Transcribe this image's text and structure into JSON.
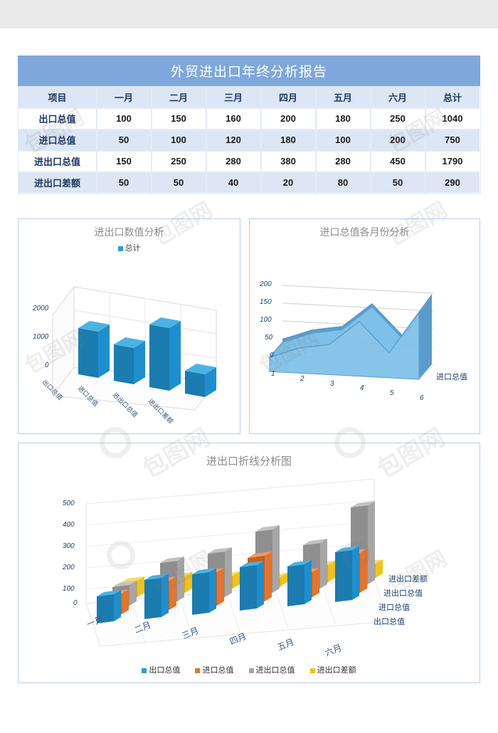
{
  "report": {
    "title": "外贸进出口年终分析报告"
  },
  "table": {
    "headers": [
      "项目",
      "一月",
      "二月",
      "三月",
      "四月",
      "五月",
      "六月",
      "总计"
    ],
    "rows": [
      {
        "label": "出口总值",
        "values": [
          100,
          150,
          160,
          200,
          180,
          250,
          1040
        ]
      },
      {
        "label": "进口总值",
        "values": [
          50,
          100,
          120,
          180,
          100,
          200,
          750
        ]
      },
      {
        "label": "进出口总值",
        "values": [
          150,
          250,
          280,
          380,
          280,
          450,
          1790
        ]
      },
      {
        "label": "进出口差额",
        "values": [
          50,
          50,
          40,
          20,
          80,
          50,
          290
        ]
      }
    ]
  },
  "colors": {
    "title_band": "#7FA7DC",
    "table_header": "#DCE6F4",
    "table_alt_row": "#DCE6F4",
    "series_export": "#2E9BD6",
    "series_import": "#E8732A",
    "series_total": "#A6A6A6",
    "series_diff": "#F2C218",
    "area_fill": "#7EC0E8",
    "panel_border": "#B9CDEA"
  },
  "chart_data": [
    {
      "id": "chart-values-analysis",
      "type": "bar",
      "title": "进出口数值分析",
      "legend": [
        "总计"
      ],
      "legend_position": "top",
      "categories": [
        "出口总值",
        "进口总值",
        "进出口总值",
        "进出口差额"
      ],
      "values": [
        1040,
        750,
        1790,
        290
      ],
      "ylabel": "",
      "xlabel": "",
      "yticks": [
        0,
        1000,
        2000
      ],
      "ylim": [
        0,
        2000
      ],
      "grid": true,
      "three_d": true
    },
    {
      "id": "chart-import-monthly",
      "type": "area",
      "title": "进口总值各月份分析",
      "series_name": "进口总值",
      "categories": [
        "1",
        "2",
        "3",
        "4",
        "5",
        "6"
      ],
      "values": [
        50,
        100,
        120,
        180,
        100,
        200
      ],
      "yticks": [
        0,
        50,
        100,
        150,
        200
      ],
      "ylim": [
        0,
        200
      ],
      "xlabel": "",
      "ylabel": "",
      "grid": true,
      "three_d": true
    },
    {
      "id": "chart-trade-breakdown",
      "type": "bar",
      "title": "进出口折线分析图",
      "categories": [
        "一月",
        "二月",
        "三月",
        "四月",
        "五月",
        "六月"
      ],
      "series": [
        {
          "name": "出口总值",
          "values": [
            100,
            150,
            160,
            200,
            180,
            250
          ]
        },
        {
          "name": "进口总值",
          "values": [
            50,
            100,
            120,
            180,
            100,
            200
          ]
        },
        {
          "name": "进出口总值",
          "values": [
            150,
            250,
            280,
            380,
            280,
            450
          ]
        },
        {
          "name": "进出口差额",
          "values": [
            50,
            50,
            40,
            20,
            80,
            50
          ]
        }
      ],
      "series_axis_labels": [
        "进出口差额",
        "进出口总值",
        "进口总值",
        "出口总值"
      ],
      "yticks": [
        0,
        100,
        200,
        300,
        400,
        500
      ],
      "ylim": [
        0,
        500
      ],
      "legend": [
        "出口总值",
        "进口总值",
        "进出口总值",
        "进出口差额"
      ],
      "legend_position": "bottom",
      "grid": true,
      "three_d": true
    }
  ]
}
